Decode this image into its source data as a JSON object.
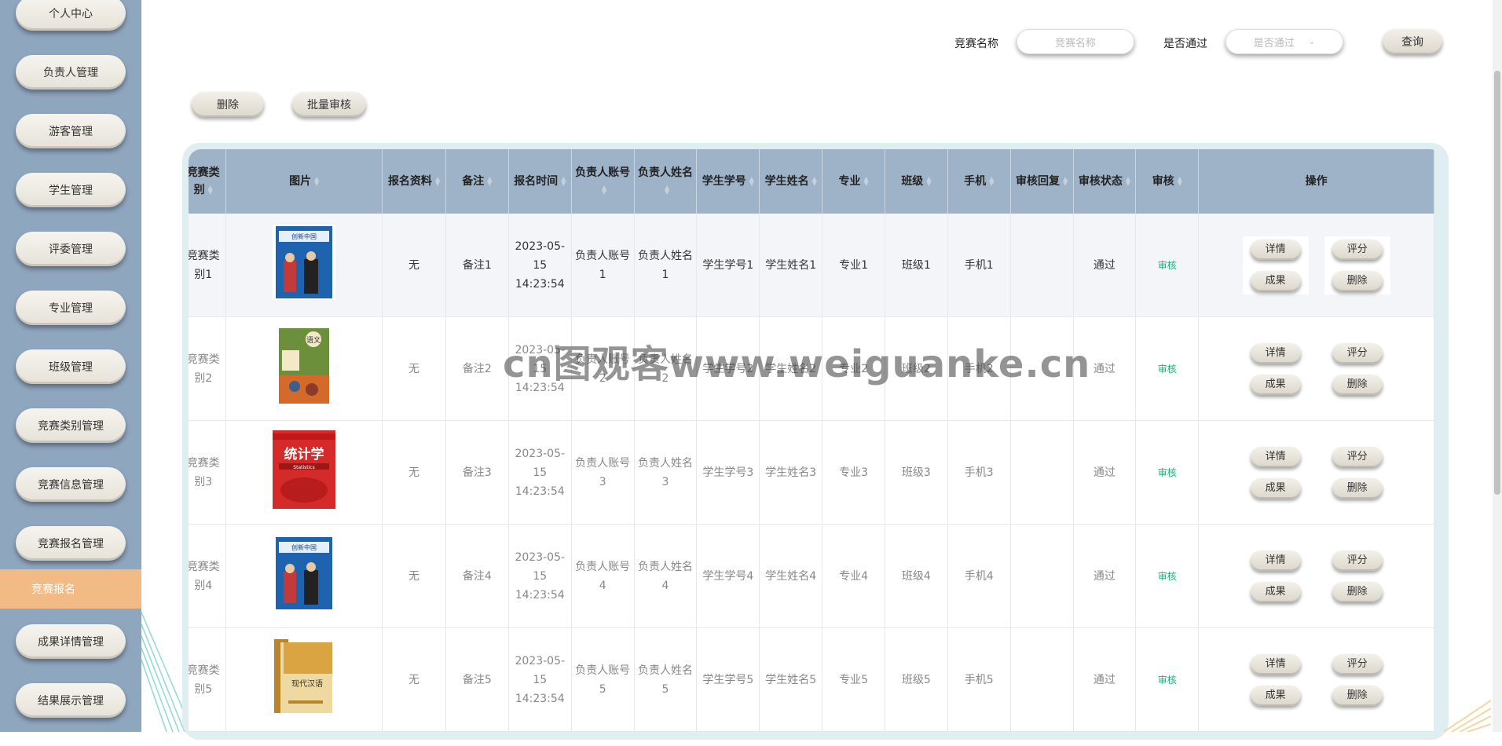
{
  "sidebar": {
    "items": [
      "个人中心",
      "负责人管理",
      "游客管理",
      "学生管理",
      "评委管理",
      "专业管理",
      "班级管理",
      "竞赛类别管理",
      "竞赛信息管理",
      "竞赛报名管理"
    ],
    "active": "竞赛报名",
    "items_after": [
      "成果详情管理",
      "结果展示管理"
    ]
  },
  "search": {
    "name_label": "竞赛名称",
    "name_placeholder": "竞赛名称",
    "pass_label": "是否通过",
    "pass_placeholder": "是否通过",
    "query_label": "查询"
  },
  "toolbar": {
    "delete_label": "删除",
    "batch_audit_label": "批量审核"
  },
  "table": {
    "headers": [
      "竞赛类别",
      "图片",
      "报名资料",
      "备注",
      "报名时间",
      "负责人账号",
      "负责人姓名",
      "学生学号",
      "学生姓名",
      "专业",
      "班级",
      "手机",
      "审核回复",
      "审核状态",
      "审核",
      "操作"
    ],
    "rows": [
      {
        "category": "竞赛类别1",
        "material": "无",
        "note": "备注1",
        "time": "2023-05-15 14:23:54",
        "leader_account": "负责人账号1",
        "leader_name": "负责人姓名1",
        "student_no": "学生学号1",
        "student_name": "学生姓名1",
        "major": "专业1",
        "class": "班级1",
        "phone": "手机1",
        "reply": "",
        "status": "通过",
        "audit": "审核",
        "book": "创新中国"
      },
      {
        "category": "竞赛类别2",
        "material": "无",
        "note": "备注2",
        "time": "2023-05-15 14:23:54",
        "leader_account": "负责人账号2",
        "leader_name": "负责人姓名2",
        "student_no": "学生学号2",
        "student_name": "学生姓名2",
        "major": "专业2",
        "class": "班级2",
        "phone": "手机2",
        "reply": "",
        "status": "通过",
        "audit": "审核",
        "book": "语文"
      },
      {
        "category": "竞赛类别3",
        "material": "无",
        "note": "备注3",
        "time": "2023-05-15 14:23:54",
        "leader_account": "负责人账号3",
        "leader_name": "负责人姓名3",
        "student_no": "学生学号3",
        "student_name": "学生姓名3",
        "major": "专业3",
        "class": "班级3",
        "phone": "手机3",
        "reply": "",
        "status": "通过",
        "audit": "审核",
        "book": "统计学"
      },
      {
        "category": "竞赛类别4",
        "material": "无",
        "note": "备注4",
        "time": "2023-05-15 14:23:54",
        "leader_account": "负责人账号4",
        "leader_name": "负责人姓名4",
        "student_no": "学生学号4",
        "student_name": "学生姓名4",
        "major": "专业4",
        "class": "班级4",
        "phone": "手机4",
        "reply": "",
        "status": "通过",
        "audit": "审核",
        "book": "创新中国"
      },
      {
        "category": "竞赛类别5",
        "material": "无",
        "note": "备注5",
        "time": "2023-05-15 14:23:54",
        "leader_account": "负责人账号5",
        "leader_name": "负责人姓名5",
        "student_no": "学生学号5",
        "student_name": "学生姓名5",
        "major": "专业5",
        "class": "班级5",
        "phone": "手机5",
        "reply": "",
        "status": "通过",
        "audit": "审核",
        "book": "现代汉语"
      }
    ],
    "op_labels": {
      "detail": "详情",
      "score": "评分",
      "result": "成果",
      "delete": "删除"
    }
  },
  "watermark": "cn图观客www.weiguanke.cn",
  "colors": {
    "sidebar_bg": "#8fa6bf",
    "active_bg": "#f2bb85",
    "header_bg": "#9fb3c8",
    "audit_green": "#19b37a"
  }
}
